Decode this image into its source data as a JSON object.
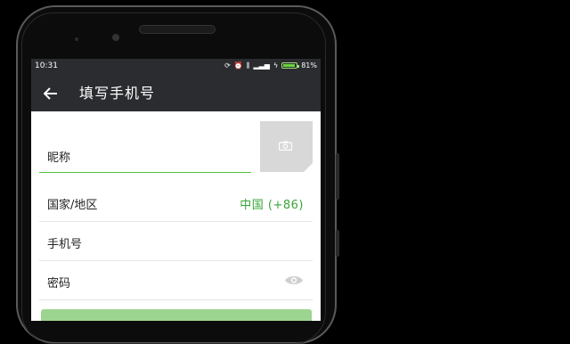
{
  "status_bar": {
    "time": "10:31",
    "battery": "81%",
    "icons": [
      "sync-icon",
      "alarm-icon",
      "vibrate-icon",
      "signal-icon",
      "charging-icon",
      "battery-icon"
    ]
  },
  "app_bar": {
    "back_icon": "arrow-left-icon",
    "title": "填写手机号"
  },
  "form": {
    "nickname_label": "昵称",
    "photo_icon": "camera-icon",
    "country_label": "国家/地区",
    "country_value": "中国 (+86)",
    "phone_label": "手机号",
    "password_label": "密码",
    "password_icon": "eye-icon"
  },
  "colors": {
    "accent": "#3aa33a",
    "bar": "#2b2c30",
    "button": "#9bd58f"
  }
}
